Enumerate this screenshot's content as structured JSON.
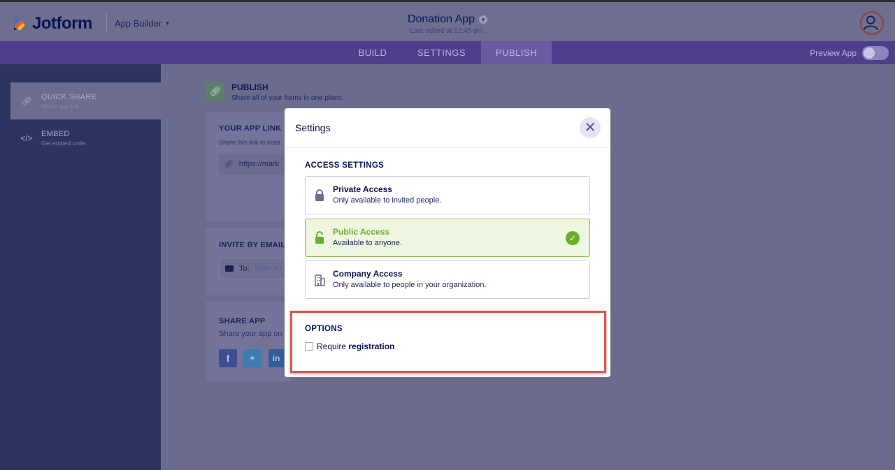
{
  "header": {
    "logo_text": "Jotform",
    "app_builder": "App Builder",
    "app_title": "Donation App",
    "last_edited": "Last edited at 12:45 pm."
  },
  "nav": {
    "tabs": [
      {
        "label": "BUILD"
      },
      {
        "label": "SETTINGS"
      },
      {
        "label": "PUBLISH",
        "active": true
      }
    ],
    "preview_label": "Preview App"
  },
  "sidebar": {
    "items": [
      {
        "title": "QUICK SHARE",
        "subtitle": "Direct app link.",
        "icon": "link-icon",
        "active": true
      },
      {
        "title": "EMBED",
        "subtitle": "Get embed code.",
        "icon": "code-icon"
      }
    ]
  },
  "main": {
    "publish_title": "PUBLISH",
    "publish_subtitle": "Share all of your forms in one place.",
    "app_link_title": "YOUR APP LINK",
    "app_link_subtitle": "Share this link to insta",
    "app_link_value": "https://mark",
    "invite_title": "INVITE BY EMAIL",
    "invite_to_label": "To:",
    "invite_placeholder": "Enter en",
    "share_title": "SHARE APP",
    "share_subtitle": "Share your app on",
    "social_icons": [
      "facebook-icon",
      "twitter-icon",
      "linkedin-icon"
    ]
  },
  "modal": {
    "title": "Settings",
    "access_title": "ACCESS SETTINGS",
    "options": [
      {
        "title": "Private Access",
        "subtitle": "Only available to invited people.",
        "icon": "lock-icon"
      },
      {
        "title": "Public Access",
        "subtitle": "Available to anyone.",
        "icon": "unlock-icon",
        "selected": true
      },
      {
        "title": "Company Access",
        "subtitle": "Only available to people in your organization.",
        "icon": "building-icon"
      }
    ],
    "options_title": "OPTIONS",
    "require_label": "Require ",
    "require_label_bold": "registration",
    "require_checked": false
  },
  "colors": {
    "accent_green": "#6aaf2c",
    "highlight_red": "#e2554b",
    "nav_purple": "#4f3e8c",
    "sidebar_navy": "#2c3462"
  }
}
